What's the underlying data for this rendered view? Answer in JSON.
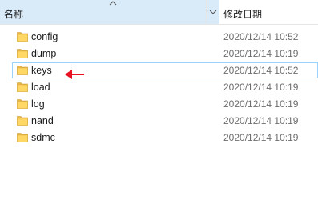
{
  "columns": {
    "name_label": "名称",
    "date_label": "修改日期"
  },
  "files": [
    {
      "name": "config",
      "date": "2020/12/14 10:52",
      "selected": false
    },
    {
      "name": "dump",
      "date": "2020/12/14 10:19",
      "selected": false
    },
    {
      "name": "keys",
      "date": "2020/12/14 10:52",
      "selected": true
    },
    {
      "name": "load",
      "date": "2020/12/14 10:19",
      "selected": false
    },
    {
      "name": "log",
      "date": "2020/12/14 10:19",
      "selected": false
    },
    {
      "name": "nand",
      "date": "2020/12/14 10:19",
      "selected": false
    },
    {
      "name": "sdmc",
      "date": "2020/12/14 10:19",
      "selected": false
    }
  ],
  "colors": {
    "header_highlight": "#d9ebf9",
    "selection_border": "#99d1ff",
    "folder": "#ffd764",
    "annotation_arrow": "#e81123"
  },
  "icons": {
    "folder": "folder-icon",
    "sort": "sort-up-icon",
    "dropdown": "chevron-down-icon",
    "annotation": "red-arrow-annotation"
  }
}
